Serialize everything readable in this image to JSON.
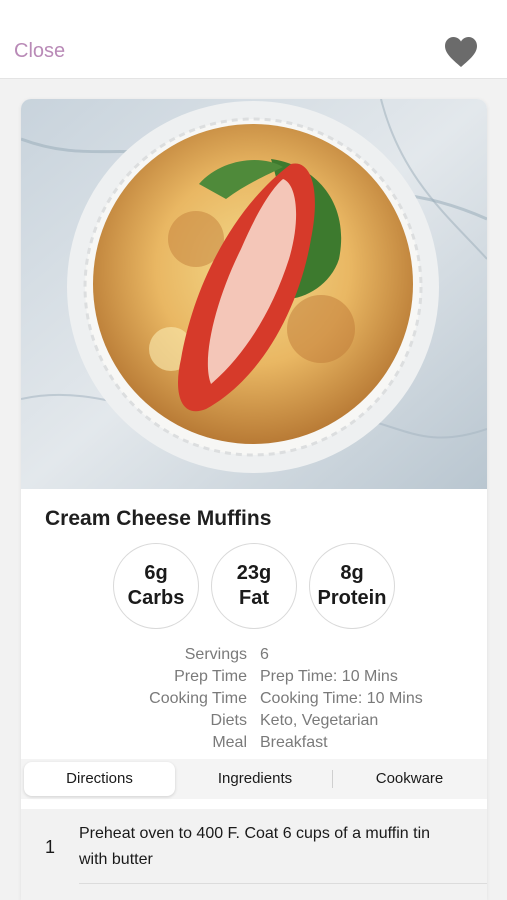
{
  "header": {
    "close_label": "Close",
    "favorite_icon": "heart-icon"
  },
  "recipe": {
    "title": "Cream Cheese Muffins",
    "image_icon": "muffin-photo",
    "macros": [
      {
        "amount": "6g",
        "label": "Carbs"
      },
      {
        "amount": "23g",
        "label": "Fat"
      },
      {
        "amount": "8g",
        "label": "Protein"
      }
    ],
    "details": [
      {
        "key": "Servings",
        "value": "6"
      },
      {
        "key": "Prep Time",
        "value": "Prep Time: 10 Mins"
      },
      {
        "key": "Cooking Time",
        "value": "Cooking Time: 10 Mins"
      },
      {
        "key": "Diets",
        "value": "Keto, Vegetarian"
      },
      {
        "key": "Meal",
        "value": "Breakfast"
      }
    ]
  },
  "tabs": [
    {
      "label": "Directions",
      "active": true
    },
    {
      "label": "Ingredients",
      "active": false
    },
    {
      "label": "Cookware",
      "active": false
    }
  ],
  "directions": [
    {
      "number": "1",
      "text": "Preheat oven to 400 F. Coat 6 cups of a muffin tin with butter"
    }
  ],
  "colors": {
    "accent": "#b98ab7",
    "heart": "#6b6b6b"
  }
}
